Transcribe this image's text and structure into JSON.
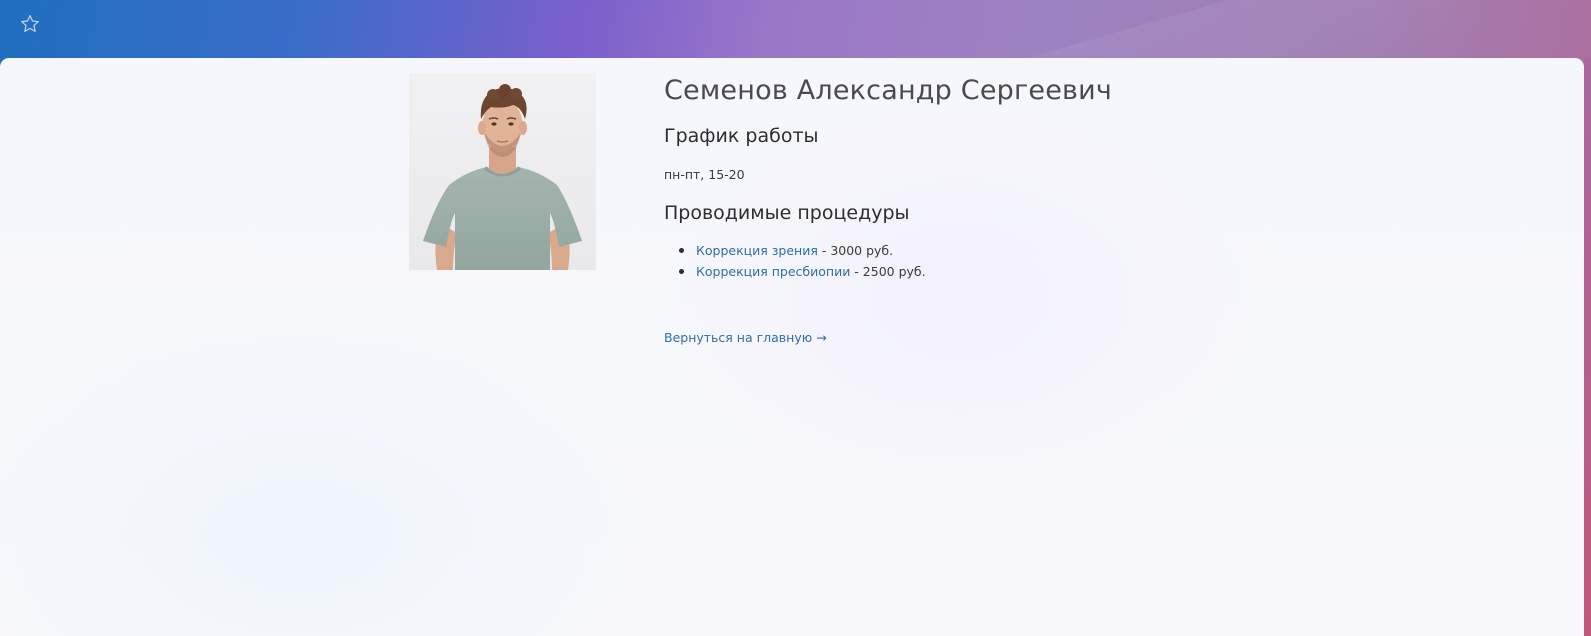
{
  "header": {
    "favorite_icon": "star-icon"
  },
  "doctor": {
    "name": "Семенов Александр Сергеевич",
    "photo_icon": "doctor-portrait-photo"
  },
  "schedule": {
    "heading": "График работы",
    "text": "пн-пт, 15-20"
  },
  "procedures": {
    "heading": "Проводимые процедуры",
    "items": [
      {
        "name": "Коррекция зрения",
        "price": " - 3000 руб."
      },
      {
        "name": "Коррекция пресбиопии",
        "price": " - 2500 руб."
      }
    ]
  },
  "back_link": {
    "label": "Вернуться на главную →"
  },
  "colors": {
    "link": "#2f6ea8",
    "text": "#3a3a3e",
    "heading": "#2d2d31",
    "name": "#4b4b4f"
  }
}
